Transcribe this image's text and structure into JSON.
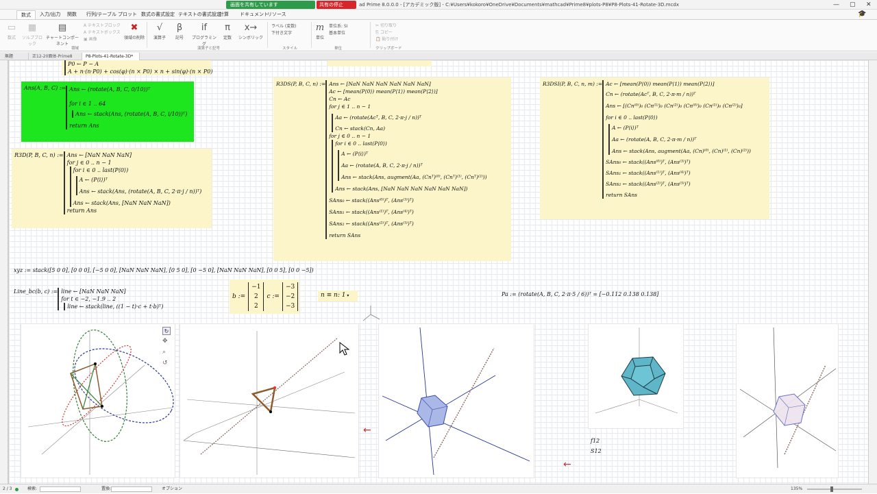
{
  "app": {
    "title_path": "ad Prime 8.0.0.0 - [アカデミック版] - C:¥Users¥kokoro¥OneDrive¥Documents¥mathcad¥Prime8¥plots-P8¥P8-Plots-41-Rotate-3D.mcdx",
    "share_label": "画面を共有しています",
    "stop_share_label": "共有の停止"
  },
  "menu": {
    "tabs": [
      "数式",
      "入力/出力",
      "関数",
      "行列/テーブル",
      "プロット",
      "数式の書式設定",
      "テキストの書式設定",
      "計算",
      "ドキュメント",
      "リソース"
    ],
    "active": "数式"
  },
  "ribbon": {
    "buttons": [
      {
        "label": "数式",
        "icon": "▭",
        "disabled": true
      },
      {
        "label": "ソルブブロック",
        "icon": "▦",
        "disabled": true
      },
      {
        "label": "チャートコンポーネント",
        "icon": "▤",
        "disabled": false
      },
      {
        "label": "テキストブロック",
        "icon": "A",
        "disabled": true
      },
      {
        "label": "テキストボックス",
        "icon": "A",
        "disabled": true
      },
      {
        "label": "画像",
        "icon": "▣",
        "disabled": true
      },
      {
        "label": "領域の削除",
        "icon": "✖",
        "disabled": false
      },
      {
        "label": "演算子",
        "icon": "√",
        "disabled": false
      },
      {
        "label": "記号",
        "icon": "β",
        "disabled": false
      },
      {
        "label": "プログラミング",
        "icon": "if",
        "disabled": false
      },
      {
        "label": "定数",
        "icon": "π",
        "disabled": false
      },
      {
        "label": "シンボリック",
        "icon": "x→",
        "disabled": false
      },
      {
        "label": "単位",
        "icon": "m",
        "disabled": false
      },
      {
        "label": "切り取り",
        "icon": "✂",
        "disabled": true
      },
      {
        "label": "コピー",
        "icon": "⎘",
        "disabled": true
      },
      {
        "label": "貼り付け",
        "icon": "📋",
        "disabled": true
      }
    ],
    "label_var": "ラベル (変数)",
    "subscript": "下付き文字",
    "standard_unit": "単位系: SI",
    "base_unit": "基本単位",
    "groups": [
      "領域",
      "演算子と記号",
      "スタイル",
      "単位",
      "クリップボード"
    ]
  },
  "doc_tabs": [
    "無題",
    "正12-20面体-Prime8",
    "P8-Plots-41-Rotate-3D*"
  ],
  "doc_tab_active": 2,
  "regions": {
    "top_partial": [
      "P0 ← P − A",
      "A + n·(n·P0) + cos(φ)·(n × P0) × n + sin(φ)·(n × P0)"
    ],
    "ans_def": [
      "Ans(A, B, C) := ",
      "Ans ← (rotate(A, B, C, 0/10))ᵀ",
      "for i ∈ 1 .. 64",
      "Ans ← stack(Ans, (rotate(A, B, C, i/10))ᵀ)",
      "return Ans"
    ],
    "r3d_def": [
      "R3D(P, B, C, n) := ",
      "Ans ← [NaN  NaN  NaN]",
      "for j ∈ 0 .. n − 1",
      "for i ∈ 0 .. last(P⟨0⟩)",
      "A ← (P⟨i⟩)ᵀ",
      "Ans ← stack(Ans, (rotate(A, B, C, 2·π·j / n))ᵀ)",
      "Ans ← stack(Ans, [NaN  NaN  NaN])",
      "return Ans"
    ],
    "r3ds_def": [
      "R3DS(P, B, C, n) := ",
      "Ans ← [NaN  NaN  NaN  NaN  NaN  NaN]",
      "Ac ← [mean(P⟨0⟩)  mean(P⟨1⟩)  mean(P⟨2⟩)]",
      "Cn ← Ac",
      "for j ∈ 1 .. n − 1",
      "Aa ← (rotate(Acᵀ, B, C, 2·π·j / n))ᵀ",
      "Cn ← stack(Cn, Aa)",
      "for j ∈ 0 .. n − 1",
      "for i ∈ 0 .. last(P⟨0⟩)",
      "A ← (P⟨i⟩)ᵀ",
      "Aa ← (rotate(A, B, C, 2·π·j / n))ᵀ",
      "Ans ← stack(Ans, augment(Aa, (Cnᵀ)⁽⁰⁾, (Cnᵀ)⁽¹⁾, (Cnᵀ)⁽²⁾))",
      "Ans ← stack(Ans, [NaN  NaN  NaN  NaN  NaN  NaN])",
      "SAns₀ ← stack((Ans⁽⁰⁾)ᵀ, (Ans⁽³⁾)ᵀ)",
      "SAns₁ ← stack((Ans⁽¹⁾)ᵀ, (Ans⁽⁴⁾)ᵀ)",
      "SAns₂ ← stack((Ans⁽²⁾)ᵀ, (Ans⁽⁵⁾)ᵀ)",
      "return SAns"
    ],
    "r3dsi_def": [
      "R3DSI(P, B, C, n, m) := ",
      "Ac ← [mean(P⟨0⟩)  mean(P⟨1⟩)  mean(P⟨2⟩)]",
      "Cn ← (rotate(Acᵀ, B, C, 2·π·m / n))ᵀ",
      "Ans ← [(Cn⁽⁰⁾)₀  (Cn⁽¹⁾)₀  (Cn⁽²⁾)₀  (Cn⁽⁰⁾)₀  (Cn⁽¹⁾)₀  (Cn⁽²⁾)₀]",
      "for i ∈ 0 .. last(P⟨0⟩)",
      "A ← (P⟨i⟩)ᵀ",
      "Aa ← (rotate(A, B, C, 2·π·m / n))ᵀ",
      "Ans ← stack(Ans, augment(Aa, (Cn)⁽⁰⁾, (Cn)⁽¹⁾, (Cn)⁽²⁾))",
      "SAns₀ ← stack((Ans⁽⁰⁾)ᵀ, (Ans⁽³⁾)ᵀ)",
      "SAns₁ ← stack((Ans⁽¹⁾)ᵀ, (Ans⁽⁴⁾)ᵀ)",
      "SAns₂ ← stack((Ans⁽²⁾)ᵀ, (Ans⁽⁵⁾)ᵀ)",
      "return SAns"
    ],
    "xyz_def": "xyz := stack([5 0 0], [0 0 0], [−5 0 0], [NaN NaN NaN], [0 5 0], [0 −5 0], [NaN NaN NaN], [0 0 5], [0 0 −5])",
    "line_def": [
      "Line_bc(b, c) := ",
      "line ← [NaN  NaN  NaN]",
      "for t ∈ −2, −1.9 .. 2",
      "line ← stack(line, ((1 − t)·c + t·b)ᵀ)"
    ],
    "b_label": "b :=",
    "b_values": [
      "−1",
      "2",
      "2"
    ],
    "c_label": "c :=",
    "c_values": [
      "−3",
      "−2",
      "−3"
    ],
    "n_def": "n ≡ n: 1",
    "pa_def": "Pa := (rotate(A, B, C, 2·π·5 / 6))ᵀ = [−0.112  0.138  0.138]"
  },
  "plots": {
    "p4_labels": [
      "f12",
      "S12"
    ]
  },
  "status": {
    "page": "2 / 3",
    "search_label": "検索:",
    "replace_label": "置換:",
    "options_label": "オプション",
    "zoom": "135%"
  }
}
